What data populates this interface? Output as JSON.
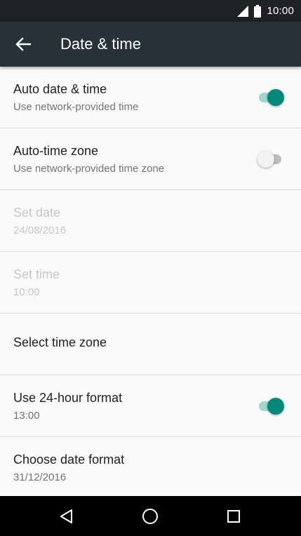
{
  "status_bar": {
    "time": "10:00",
    "icons": [
      "signal-icon",
      "battery-icon"
    ]
  },
  "app_bar": {
    "title": "Date & time",
    "back_icon": "arrow-back-icon"
  },
  "settings": [
    {
      "title": "Auto date & time",
      "summary": "Use network-provided time",
      "toggle": true,
      "enabled": true
    },
    {
      "title": "Auto-time zone",
      "summary": "Use network-provided time zone",
      "toggle": false,
      "enabled": true
    },
    {
      "title": "Set date",
      "summary": "24/08/2016",
      "enabled": false
    },
    {
      "title": "Set time",
      "summary": "10:00",
      "enabled": false
    },
    {
      "title": "Select time zone",
      "summary": "",
      "enabled": true
    },
    {
      "title": "Use 24-hour format",
      "summary": "13:00",
      "toggle": true,
      "enabled": true
    },
    {
      "title": "Choose date format",
      "summary": "31/12/2016",
      "enabled": true
    }
  ],
  "nav_bar": {
    "buttons": [
      "back-triangle-icon",
      "home-circle-icon",
      "recents-square-icon"
    ]
  },
  "colors": {
    "accent": "#00897b",
    "app_bar": "#263238",
    "status_bar": "#1f2124"
  }
}
